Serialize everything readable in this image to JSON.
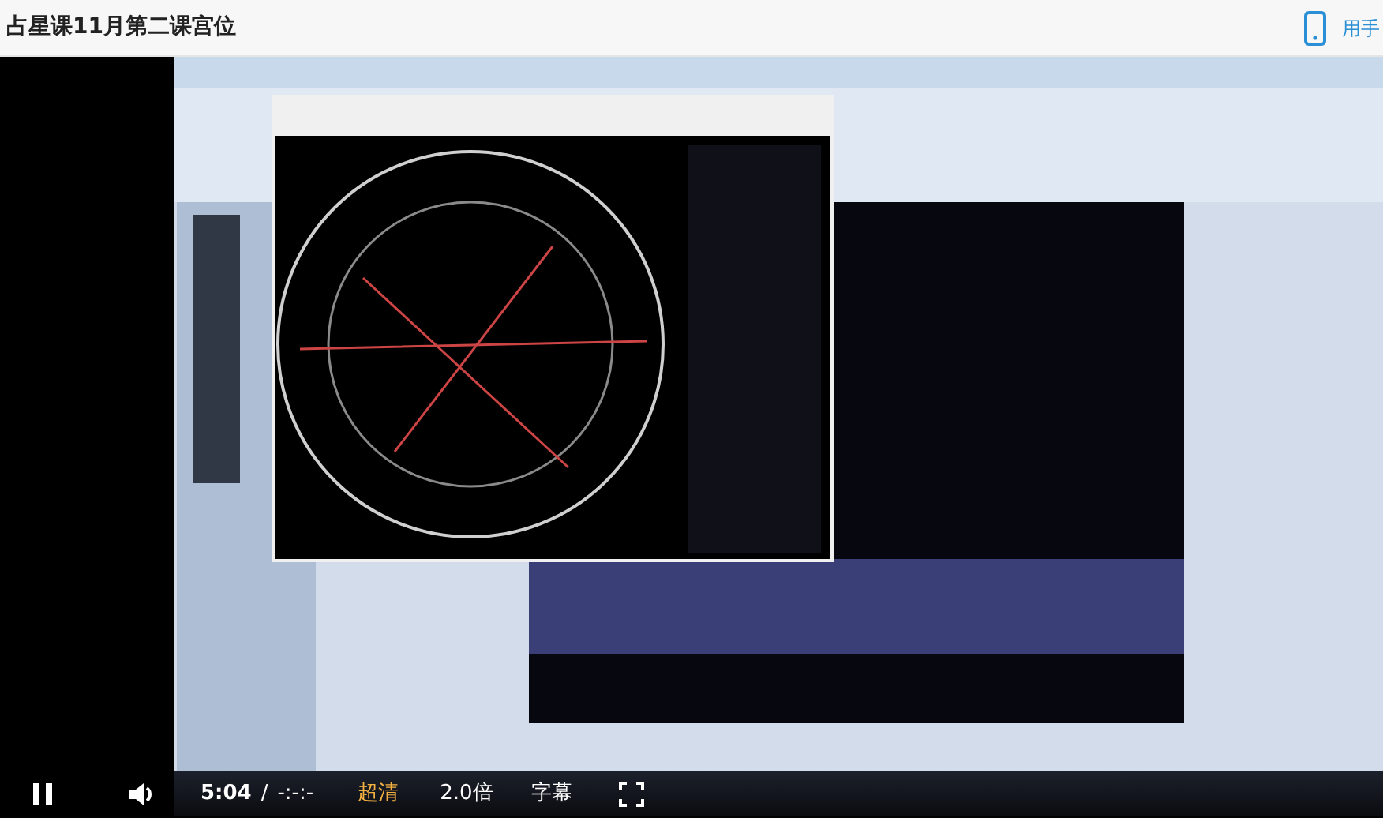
{
  "header": {
    "title": "占星课11月第二课宫位",
    "app_link": "用手"
  },
  "controls": {
    "playing": true,
    "current_time": "5:04",
    "separator": "/",
    "duration": "-:-:-",
    "quality": "超清",
    "speed": "2.0倍",
    "subtitles": "字幕"
  }
}
